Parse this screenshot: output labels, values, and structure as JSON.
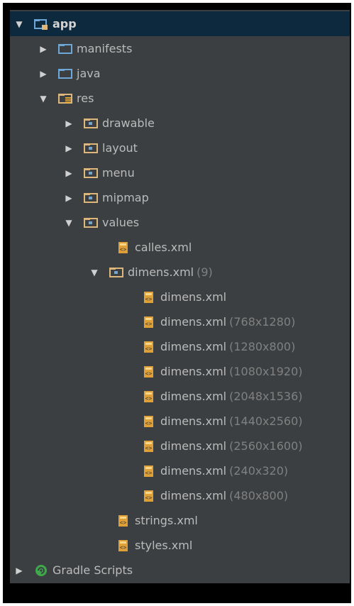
{
  "tree": {
    "app": {
      "label": "app",
      "arrow": "▼"
    },
    "manifests": {
      "label": "manifests",
      "arrow": "▶"
    },
    "java": {
      "label": "java",
      "arrow": "▶"
    },
    "res": {
      "label": "res",
      "arrow": "▼"
    },
    "drawable": {
      "label": "drawable",
      "arrow": "▶"
    },
    "layout": {
      "label": "layout",
      "arrow": "▶"
    },
    "menu": {
      "label": "menu",
      "arrow": "▶"
    },
    "mipmap": {
      "label": "mipmap",
      "arrow": "▶"
    },
    "values": {
      "label": "values",
      "arrow": "▼"
    },
    "calles": {
      "label": "calles.xml"
    },
    "dimens_group": {
      "label": "dimens.xml",
      "count": "(9)",
      "arrow": "▼"
    },
    "dimens_files": [
      {
        "label": "dimens.xml",
        "qualifier": ""
      },
      {
        "label": "dimens.xml",
        "qualifier": "(768x1280)"
      },
      {
        "label": "dimens.xml",
        "qualifier": "(1280x800)"
      },
      {
        "label": "dimens.xml",
        "qualifier": "(1080x1920)"
      },
      {
        "label": "dimens.xml",
        "qualifier": "(2048x1536)"
      },
      {
        "label": "dimens.xml",
        "qualifier": "(1440x2560)"
      },
      {
        "label": "dimens.xml",
        "qualifier": "(2560x1600)"
      },
      {
        "label": "dimens.xml",
        "qualifier": "(240x320)"
      },
      {
        "label": "dimens.xml",
        "qualifier": "(480x800)"
      }
    ],
    "strings": {
      "label": "strings.xml"
    },
    "styles": {
      "label": "styles.xml"
    },
    "gradle": {
      "label": "Gradle Scripts",
      "arrow": "▶"
    }
  },
  "colors": {
    "panel_bg": "#3c3f41",
    "selection_bg": "#0d293e",
    "folder_blue": "#6ea6d8",
    "res_folder": "#dcb67a",
    "xml_orange": "#e0a035",
    "gradle_green": "#3ea84a"
  }
}
